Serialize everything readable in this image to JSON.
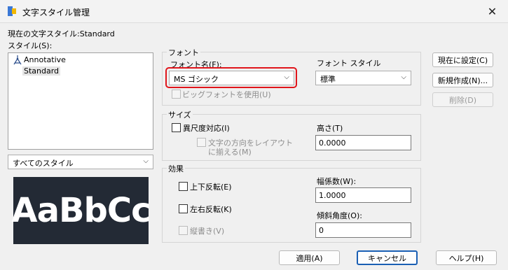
{
  "window": {
    "title": "文字スタイル管理",
    "close_glyph": "✕"
  },
  "current_style_label": "現在の文字スタイル:Standard",
  "styles_label": "スタイル(S):",
  "styles": [
    {
      "label": "Annotative",
      "icon": "annotative-icon"
    },
    {
      "label": "Standard",
      "icon": ""
    }
  ],
  "style_filter": {
    "value": "すべてのスタイル"
  },
  "preview_text": "AaBbCc",
  "font_group": {
    "label": "フォント",
    "font_name_label": "フォント名(F):",
    "font_name_value": "MS ゴシック",
    "font_style_label": "フォント スタイル",
    "font_style_value": "標準",
    "bigfont_label": "ビッグフォントを使用(U)"
  },
  "size_group": {
    "label": "サイズ",
    "annotative_label": "異尺度対応(I)",
    "match_orientation_label_line1": "文字の方向をレイアウト",
    "match_orientation_label_line2": "に揃える(M)",
    "height_label": "高さ(T)",
    "height_value": "0.0000"
  },
  "effects_group": {
    "label": "効果",
    "upside_down_label": "上下反転(E)",
    "backwards_label": "左右反転(K)",
    "vertical_label": "縦書き(V)",
    "width_factor_label": "幅係数(W):",
    "width_factor_value": "1.0000",
    "oblique_label": "傾斜角度(O):",
    "oblique_value": "0"
  },
  "buttons": {
    "set_current": "現在に設定(C)",
    "new": "新規作成(N)...",
    "delete": "削除(D)",
    "apply": "適用(A)",
    "cancel": "キャンセル",
    "help": "ヘルプ(H)"
  },
  "colors": {
    "highlight": "#e0151b",
    "preview_bg": "#232a35",
    "default_button_border": "#1a5fb4"
  }
}
